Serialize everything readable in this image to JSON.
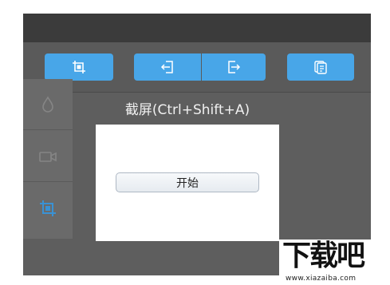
{
  "toolbar": {
    "buttons": [
      {
        "icon": "screenshot-capture-icon"
      },
      {
        "icon": "import-arrow-icon"
      },
      {
        "icon": "export-arrow-icon"
      },
      {
        "icon": "copy-document-icon"
      }
    ],
    "accent_color": "#48a6e8"
  },
  "side_panel": {
    "items": [
      {
        "icon": "water-drop-icon"
      },
      {
        "icon": "video-camera-icon"
      },
      {
        "icon": "screenshot-crop-icon",
        "active": true
      }
    ],
    "active_color": "#3a92d4"
  },
  "dialog": {
    "title": "截屏(Ctrl+Shift+A)",
    "start_label": "开始"
  },
  "watermark": {
    "logo": "下载吧",
    "url": "www.xiazaiba.com"
  }
}
